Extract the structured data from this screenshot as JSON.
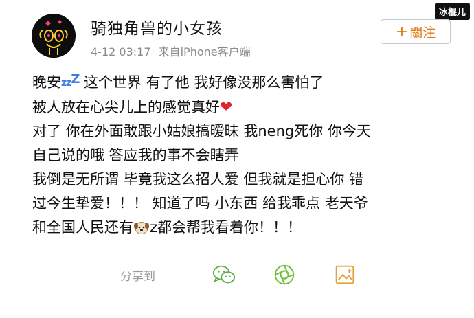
{
  "watermark": "冰棍儿",
  "post": {
    "username": "骑独角兽的小女孩",
    "timestamp": "4-12 03:17",
    "source": "来自iPhone客户端",
    "follow_label": "關注",
    "follow_plus": "+",
    "lines": [
      {
        "before": "晚安",
        "zzz_small": "z",
        "zzz_mid": "z",
        "zzz_big": "Z",
        "after": " 这个世界 有了他 我好像没那么害怕了"
      },
      {
        "text": "被人放在心尖儿上的感觉真好",
        "emoji": "❤"
      },
      {
        "text": "对了 你在外面敢跟小姑娘搞暧昧 我neng死你 你今天"
      },
      {
        "text": "自己说的哦 答应我的事不会瞎弄"
      },
      {
        "text": "我倒是无所谓 毕竟我这么招人爱 但我就是担心你 错"
      },
      {
        "text": "过今生挚爱！！！ 知道了吗 小东西 给我乖点 老天爷"
      },
      {
        "before": "和全国人民还有",
        "after": "z都会帮我看着你！！！"
      }
    ]
  },
  "share": {
    "label": "分享到",
    "icons": [
      "wechat-icon",
      "moments-icon",
      "save-image-icon"
    ]
  }
}
